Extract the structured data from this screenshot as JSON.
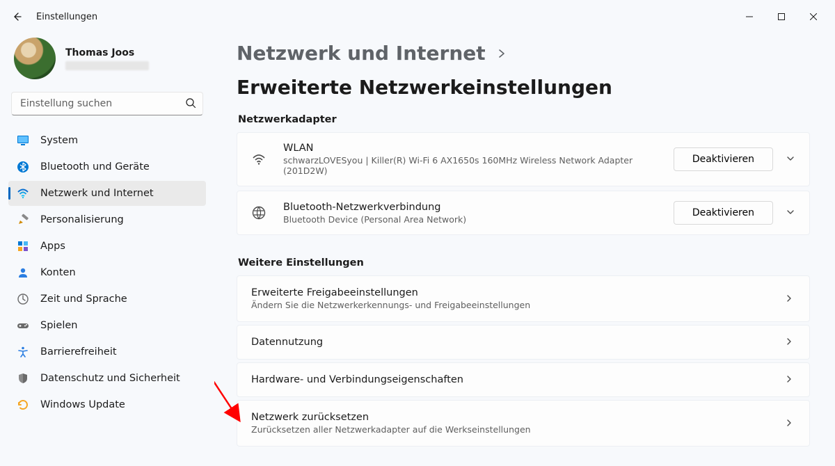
{
  "window": {
    "title": "Einstellungen"
  },
  "user": {
    "name": "Thomas Joos"
  },
  "search": {
    "placeholder": "Einstellung suchen"
  },
  "nav": {
    "items": [
      {
        "label": "System"
      },
      {
        "label": "Bluetooth und Geräte"
      },
      {
        "label": "Netzwerk und Internet"
      },
      {
        "label": "Personalisierung"
      },
      {
        "label": "Apps"
      },
      {
        "label": "Konten"
      },
      {
        "label": "Zeit und Sprache"
      },
      {
        "label": "Spielen"
      },
      {
        "label": "Barrierefreiheit"
      },
      {
        "label": "Datenschutz und Sicherheit"
      },
      {
        "label": "Windows Update"
      }
    ]
  },
  "breadcrumb": {
    "parent": "Netzwerk und Internet",
    "current": "Erweiterte Netzwerkeinstellungen"
  },
  "sections": {
    "adapters": {
      "heading": "Netzwerkadapter",
      "items": [
        {
          "title": "WLAN",
          "subtitle": "schwarzLOVESyou | Killer(R) Wi-Fi 6 AX1650s 160MHz Wireless Network Adapter (201D2W)",
          "action": "Deaktivieren"
        },
        {
          "title": "Bluetooth-Netzwerkverbindung",
          "subtitle": "Bluetooth Device (Personal Area Network)",
          "action": "Deaktivieren"
        }
      ]
    },
    "more": {
      "heading": "Weitere Einstellungen",
      "items": [
        {
          "title": "Erweiterte Freigabeeinstellungen",
          "subtitle": "Ändern Sie die Netzwerkerkennungs- und Freigabeeinstellungen"
        },
        {
          "title": "Datennutzung",
          "subtitle": ""
        },
        {
          "title": "Hardware- und Verbindungseigenschaften",
          "subtitle": ""
        },
        {
          "title": "Netzwerk zurücksetzen",
          "subtitle": "Zurücksetzen aller Netzwerkadapter auf die Werkseinstellungen"
        }
      ]
    }
  }
}
